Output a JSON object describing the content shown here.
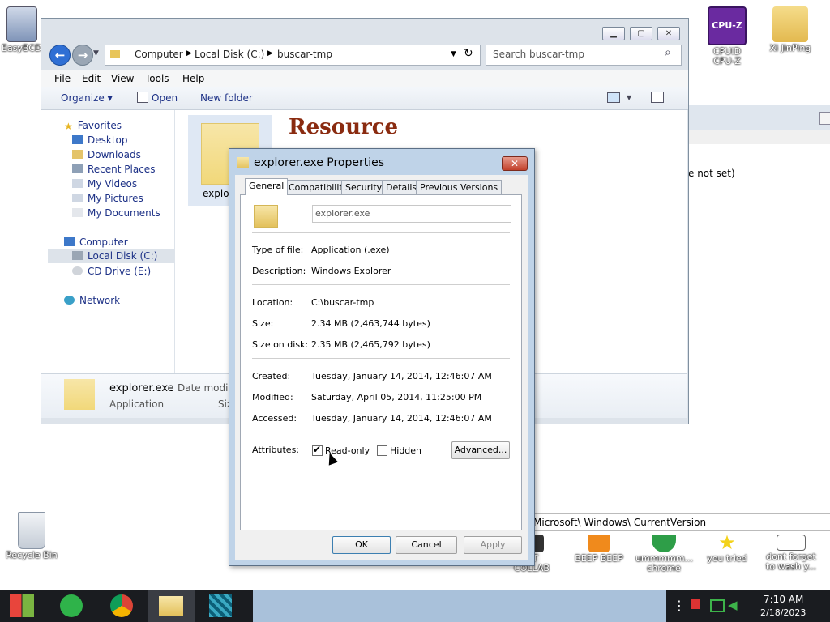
{
  "desktop": {
    "icons": [
      {
        "label": "EasyBCD"
      },
      {
        "label": "CPUID CPU-Z"
      },
      {
        "label": "Xi JinPing"
      },
      {
        "label": "Recycle Bin"
      },
      {
        "label": "OT COLLAB"
      },
      {
        "label": "BEEP BEEP"
      },
      {
        "label": "ummmmm... chrome"
      },
      {
        "label": "you tried"
      },
      {
        "label": "dont forget to wash y..."
      }
    ],
    "cpuz_badge": "CPU-Z"
  },
  "back_window": {
    "text_value": "e not set)",
    "path_text": "Microsoft\\ Windows\\ CurrentVersion"
  },
  "explorer": {
    "path": [
      "Computer",
      "Local Disk (C:)",
      "buscar-tmp"
    ],
    "search_placeholder": "Search buscar-tmp",
    "menu": [
      "File",
      "Edit",
      "View",
      "Tools",
      "Help"
    ],
    "toolbar": {
      "organize": "Organize ▾",
      "open": "Open",
      "new_folder": "New folder"
    },
    "nav": {
      "favorites": "Favorites",
      "favorites_items": [
        "Desktop",
        "Downloads",
        "Recent Places",
        "My Videos",
        "My Pictures",
        "My Documents"
      ],
      "computer": "Computer",
      "computer_items": [
        "Local Disk (C:)",
        "CD Drive (E:)"
      ],
      "network": "Network"
    },
    "content": {
      "file_label": "explor",
      "banner_text": "Resource"
    },
    "details": {
      "name": "explorer.exe",
      "date_label": "Date modifi",
      "type": "Application",
      "size_label": "Siz"
    }
  },
  "properties": {
    "title": "explorer.exe Properties",
    "tabs": [
      "General",
      "Compatibility",
      "Security",
      "Details",
      "Previous Versions"
    ],
    "filename": "explorer.exe",
    "type_label": "Type of file:",
    "type_value": "Application (.exe)",
    "desc_label": "Description:",
    "desc_value": "Windows Explorer",
    "location_label": "Location:",
    "location_value": "C:\\buscar-tmp",
    "size_label": "Size:",
    "size_value": "2.34 MB (2,463,744 bytes)",
    "sizeondisk_label": "Size on disk:",
    "sizeondisk_value": "2.35 MB (2,465,792 bytes)",
    "created_label": "Created:",
    "created_value": "Tuesday, January 14, 2014, 12:46:07 AM",
    "modified_label": "Modified:",
    "modified_value": "Saturday, April 05, 2014, 11:25:00 PM",
    "accessed_label": "Accessed:",
    "accessed_value": "Tuesday, January 14, 2014, 12:46:07 AM",
    "attributes_label": "Attributes:",
    "readonly_label": "Read-only",
    "readonly_checked": true,
    "hidden_label": "Hidden",
    "hidden_checked": false,
    "advanced_label": "Advanced...",
    "ok_label": "OK",
    "cancel_label": "Cancel",
    "apply_label": "Apply"
  },
  "taskbar": {
    "time": "7:10 AM",
    "date": "2/18/2023"
  },
  "colors": {
    "accent": "#3a6fc4",
    "taskbar": "#1a1c20",
    "dialog_frame": "#bfd3e8",
    "close_red": "#c2412b"
  }
}
